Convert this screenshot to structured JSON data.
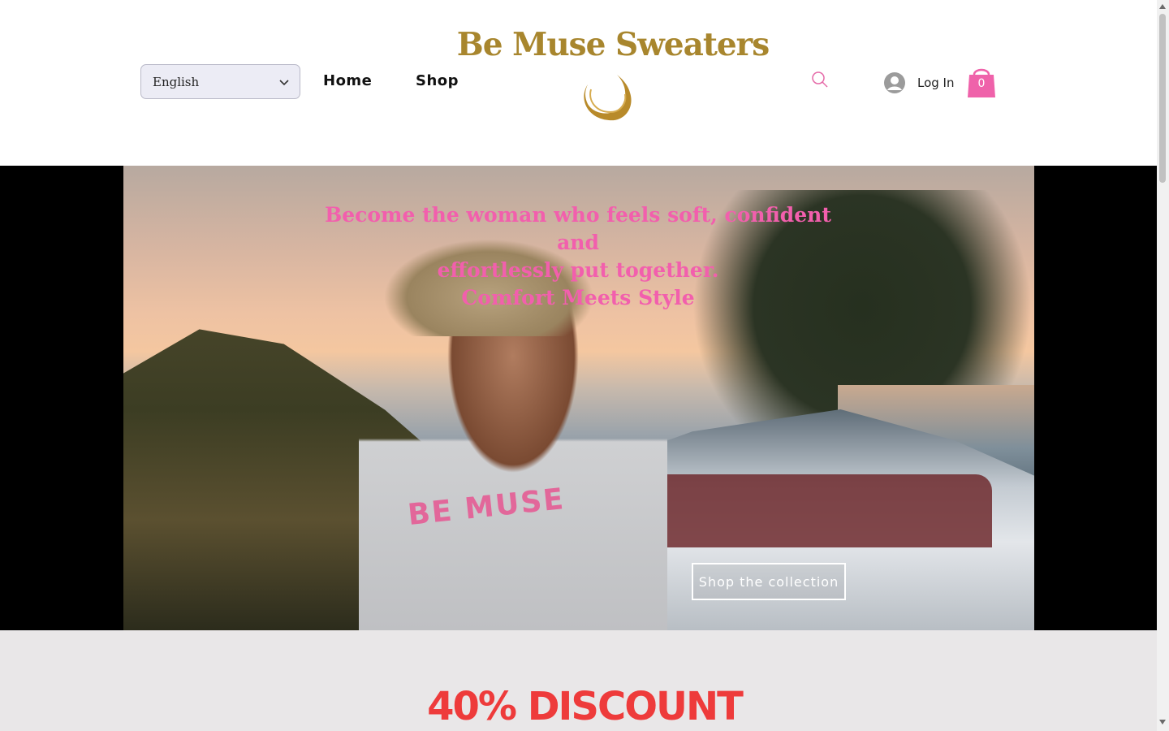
{
  "header": {
    "brand_title": "Be Muse Sweaters",
    "language": {
      "selected": "English"
    },
    "nav": {
      "home": "Home",
      "shop": "Shop"
    },
    "login_label": "Log In",
    "cart_count": "0"
  },
  "hero": {
    "tagline": {
      "line1": "Become the woman who feels soft, confident and",
      "line2": "effortlessly put together.",
      "line3": "Comfort Meets Style"
    },
    "sweater_print": "BE MUSE",
    "cta_label": "Shop the collection"
  },
  "promo": {
    "title": "40% DISCOUNT"
  },
  "colors": {
    "brand_gold": "#a8862e",
    "accent_pink": "#f25fad",
    "promo_red": "#ee3b3b"
  },
  "icons": [
    "chevron-down-icon",
    "logo-swirl",
    "search-icon",
    "user-avatar-icon",
    "shopping-bag-icon"
  ]
}
